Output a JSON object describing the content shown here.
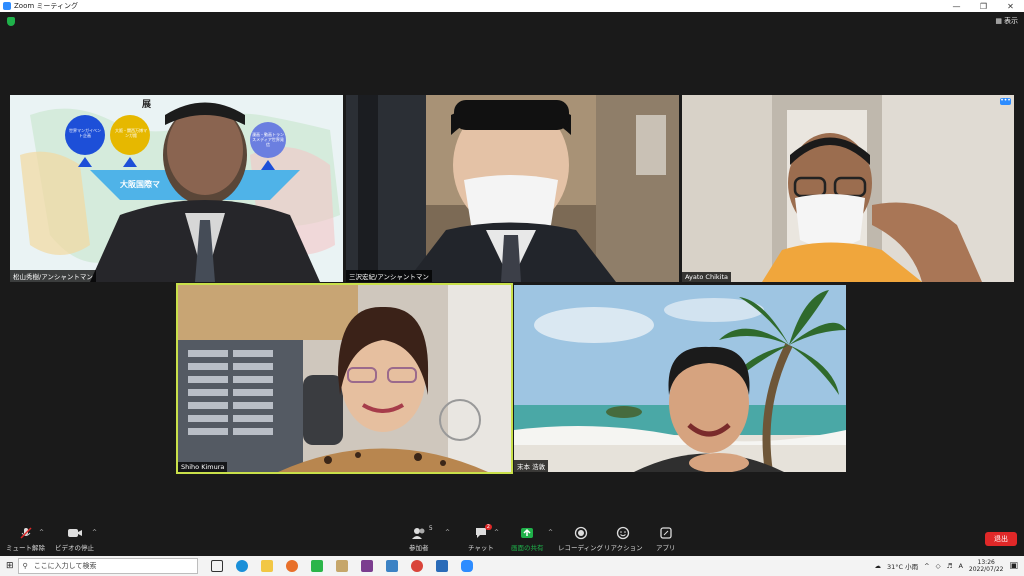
{
  "window": {
    "title": "Zoom ミーティング"
  },
  "top": {
    "view_label": "表示"
  },
  "participants": [
    {
      "name": "松山秀樹/アンシャントマン"
    },
    {
      "name": "三沢宏紀/アンシャントマン"
    },
    {
      "name": "Ayato Chikita"
    },
    {
      "name": "Shiho Kimura"
    },
    {
      "name": "末本 浩敦"
    }
  ],
  "slide": {
    "title_fragment": "展",
    "banner_text": "大阪国際マ",
    "circle_left": "世界マンガイベント企画",
    "circle_mid": "大阪・関西万博マンガ館",
    "circle_right": "漫画・動画トランスメディア世界発信"
  },
  "toolbar": {
    "mute_label": "ミュート解除",
    "video_label": "ビデオの停止",
    "participants_label": "参加者",
    "participants_count": "5",
    "chat_label": "チャット",
    "chat_badge": "2",
    "share_label": "画面の共有",
    "record_label": "レコーディング",
    "reactions_label": "リアクション",
    "apps_label": "アプリ",
    "leave_label": "退出"
  },
  "taskbar": {
    "search_placeholder": "ここに入力して検索",
    "weather": "31°C 小雨",
    "ime": "A",
    "time": "13:26",
    "date": "2022/07/22"
  }
}
